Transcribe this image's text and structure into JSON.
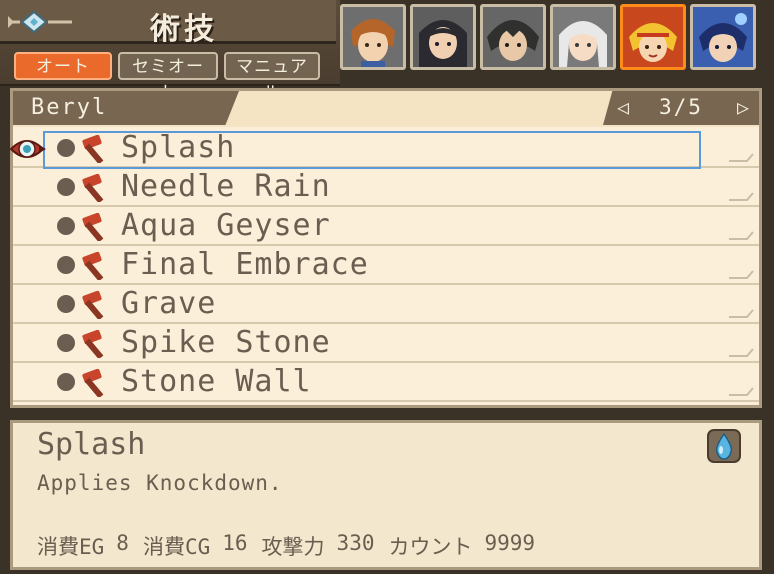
{
  "header": {
    "title": "術技",
    "mode_tabs": [
      {
        "label": "オート",
        "active": true
      },
      {
        "label": "セミオート",
        "active": false
      },
      {
        "label": "マニュアル",
        "active": false
      }
    ]
  },
  "portraits": [
    {
      "id": "char1",
      "active": false
    },
    {
      "id": "char2",
      "active": false
    },
    {
      "id": "char3",
      "active": false
    },
    {
      "id": "char4",
      "active": false
    },
    {
      "id": "char5",
      "active": true
    },
    {
      "id": "char6",
      "active": false
    }
  ],
  "character": {
    "name": "Beryl",
    "page": "3/5",
    "prev_icon": "◁",
    "next_icon": "▷"
  },
  "skills": [
    {
      "name": "Splash",
      "selected": true
    },
    {
      "name": "Needle Rain",
      "selected": false
    },
    {
      "name": "Aqua Geyser",
      "selected": false
    },
    {
      "name": "Final Embrace",
      "selected": false
    },
    {
      "name": "Grave",
      "selected": false
    },
    {
      "name": "Spike Stone",
      "selected": false
    },
    {
      "name": "Stone Wall",
      "selected": false
    }
  ],
  "description": {
    "title": "Splash",
    "text": "Applies Knockdown.",
    "element_icon": "water-drop-icon",
    "stats": [
      {
        "label": "消費EG",
        "value": "8"
      },
      {
        "label": "消費CG",
        "value": "16"
      },
      {
        "label": "攻撃力",
        "value": "330"
      },
      {
        "label": "カウント",
        "value": "9999"
      }
    ]
  },
  "colors": {
    "accent_orange": "#e96a2a",
    "text_brown": "#6b5d50",
    "panel_bg": "#fbefd9",
    "selection_blue": "#5a9ad8"
  }
}
